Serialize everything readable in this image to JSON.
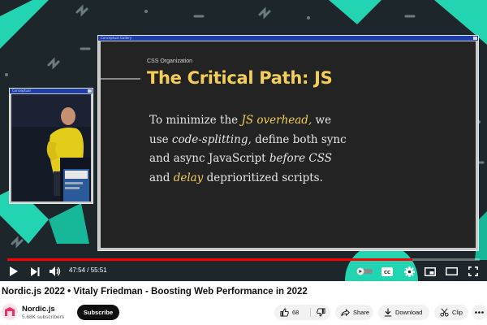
{
  "slide": {
    "window_title": "Conceptual Gallery",
    "kicker": "CSS Organization",
    "title": "The Critical Path: JS",
    "body": {
      "l1_a": "To minimize the ",
      "l1_hl": "JS overhead,",
      "l1_b": " we",
      "l2_a": "use ",
      "l2_it": "code-splitting,",
      "l2_b": " define both sync",
      "l3_a": "and async JavaScript ",
      "l3_it": "before CSS",
      "l4_hl": "delay",
      "l4_a": "and ",
      "l4_b": " deprioritized scripts."
    }
  },
  "cam": {
    "window_title": "Conceptual"
  },
  "player": {
    "time_display": "47:54 / 55:51",
    "progress_fraction": 0.858,
    "accent_color": "#ff0000",
    "icons": [
      "play-icon",
      "next-icon",
      "volume-icon",
      "autoplay-toggle",
      "captions-icon",
      "settings-icon",
      "miniplayer-icon",
      "theater-icon",
      "fullscreen-icon"
    ],
    "captions_label": "CC"
  },
  "video": {
    "title": "Nordic.js 2022 • Vitaly Friedman - Boosting Web Performance in 2022",
    "channel_name": "Nordic.js",
    "subscribers": "5.68K subscribers",
    "subscribe_label": "Subscribe",
    "like_count": "68",
    "share_label": "Share",
    "download_label": "Download",
    "clip_label": "Clip"
  }
}
